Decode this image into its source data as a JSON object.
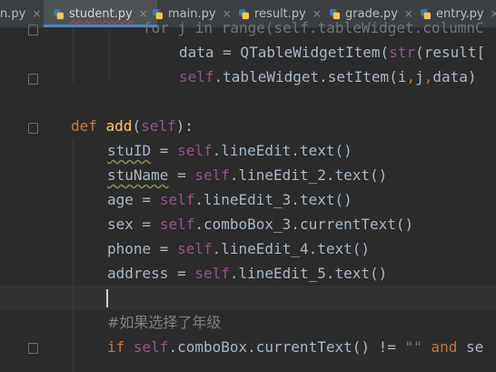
{
  "tabs": [
    {
      "label": "n.py",
      "close": "×"
    },
    {
      "label": "student.py",
      "close": "×"
    },
    {
      "label": "main.py",
      "close": "×"
    },
    {
      "label": "result.py",
      "close": "×"
    },
    {
      "label": "grade.py",
      "close": "×"
    },
    {
      "label": "entry.py",
      "close": "×"
    }
  ],
  "code": {
    "l0": "for j in range(self.tableWidget.columnC",
    "l1a": "data = QTableWidgetItem(",
    "l1b": "str",
    "l1c": "(result[",
    "l2self": "self",
    "l2rest": ".tableWidget.setItem(i",
    "comma1": ",",
    "l2j": "j",
    "comma2": ",",
    "l2end": "data)",
    "def_kw": "def ",
    "def_name": "add",
    "def_open": "(",
    "def_self": "self",
    "def_close": "):",
    "stuID_var": "stuID",
    "stuID_rest": ".lineEdit.text()",
    "stuName_var": "stuName",
    "stuName_rest": ".lineEdit_2.text()",
    "age_var": "age",
    "age_rest": ".lineEdit_3.text()",
    "sex_var": "sex",
    "sex_rest": ".comboBox_3.currentText()",
    "phone_var": "phone",
    "phone_rest": ".lineEdit_4.text()",
    "address_var": "address",
    "address_rest": ".lineEdit_5.text()",
    "eq": " = ",
    "self": "self",
    "comment": "#如果选择了年级",
    "if_kw": "if ",
    "if_rest": ".comboBox.currentText() != ",
    "if_str": "\"\"",
    "and_kw": " and ",
    "tail": "se"
  },
  "colors": {
    "background": "#2b2b2b",
    "keyword": "#cc7832",
    "self": "#94558d",
    "function": "#ffc66d",
    "string": "#6a8759",
    "comment": "#808080",
    "text": "#a9b7c6"
  },
  "icons": [
    "python-file-icon",
    "close-icon",
    "fold-marker-icon",
    "text-caret"
  ]
}
